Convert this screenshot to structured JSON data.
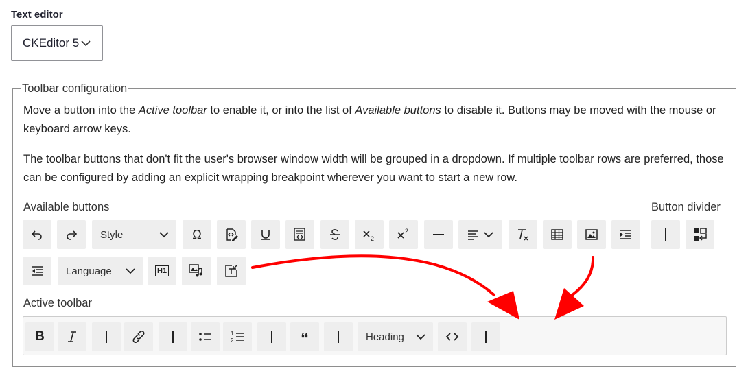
{
  "editor": {
    "label": "Text editor",
    "selected": "CKEditor 5"
  },
  "fieldset": {
    "legend": "Toolbar configuration",
    "desc1": {
      "a": "Move a button into the ",
      "b": "Active toolbar",
      "c": " to enable it, or into the list of ",
      "d": "Available buttons",
      "e": " to disable it. Buttons may be moved with the mouse or keyboard arrow keys."
    },
    "desc2": "The toolbar buttons that don't fit the user's browser window width will be grouped in a dropdown. If multiple toolbar rows are preferred, those can be configured by adding an explicit wrapping breakpoint wherever you want to start a new row.",
    "available_label": "Available buttons",
    "divider_label": "Button divider",
    "active_label": "Active toolbar"
  },
  "available_buttons": [
    {
      "name": "undo-icon"
    },
    {
      "name": "redo-icon"
    },
    {
      "name": "style-dropdown",
      "label": "Style"
    },
    {
      "name": "omega-icon"
    },
    {
      "name": "source-edit-icon"
    },
    {
      "name": "underline-icon"
    },
    {
      "name": "html-embed-icon"
    },
    {
      "name": "strikethrough-icon"
    },
    {
      "name": "subscript-icon"
    },
    {
      "name": "superscript-icon"
    },
    {
      "name": "horizontal-line-icon"
    },
    {
      "name": "align-icon"
    },
    {
      "name": "remove-format-icon"
    },
    {
      "name": "table-icon"
    },
    {
      "name": "image-icon"
    },
    {
      "name": "indent-icon"
    },
    {
      "name": "outdent-icon"
    },
    {
      "name": "language-dropdown",
      "label": "Language"
    },
    {
      "name": "heading-h1-icon",
      "text": "H1"
    },
    {
      "name": "media-embed-icon"
    },
    {
      "name": "special-insert-icon"
    }
  ],
  "divider_buttons": [
    {
      "name": "divider-icon"
    },
    {
      "name": "wrap-icon"
    }
  ],
  "active_toolbar": {
    "heading_label": "Heading"
  },
  "colors": {
    "button_bg": "#eeeeee",
    "arrow": "#ff0000",
    "border": "#8e8e8e"
  }
}
